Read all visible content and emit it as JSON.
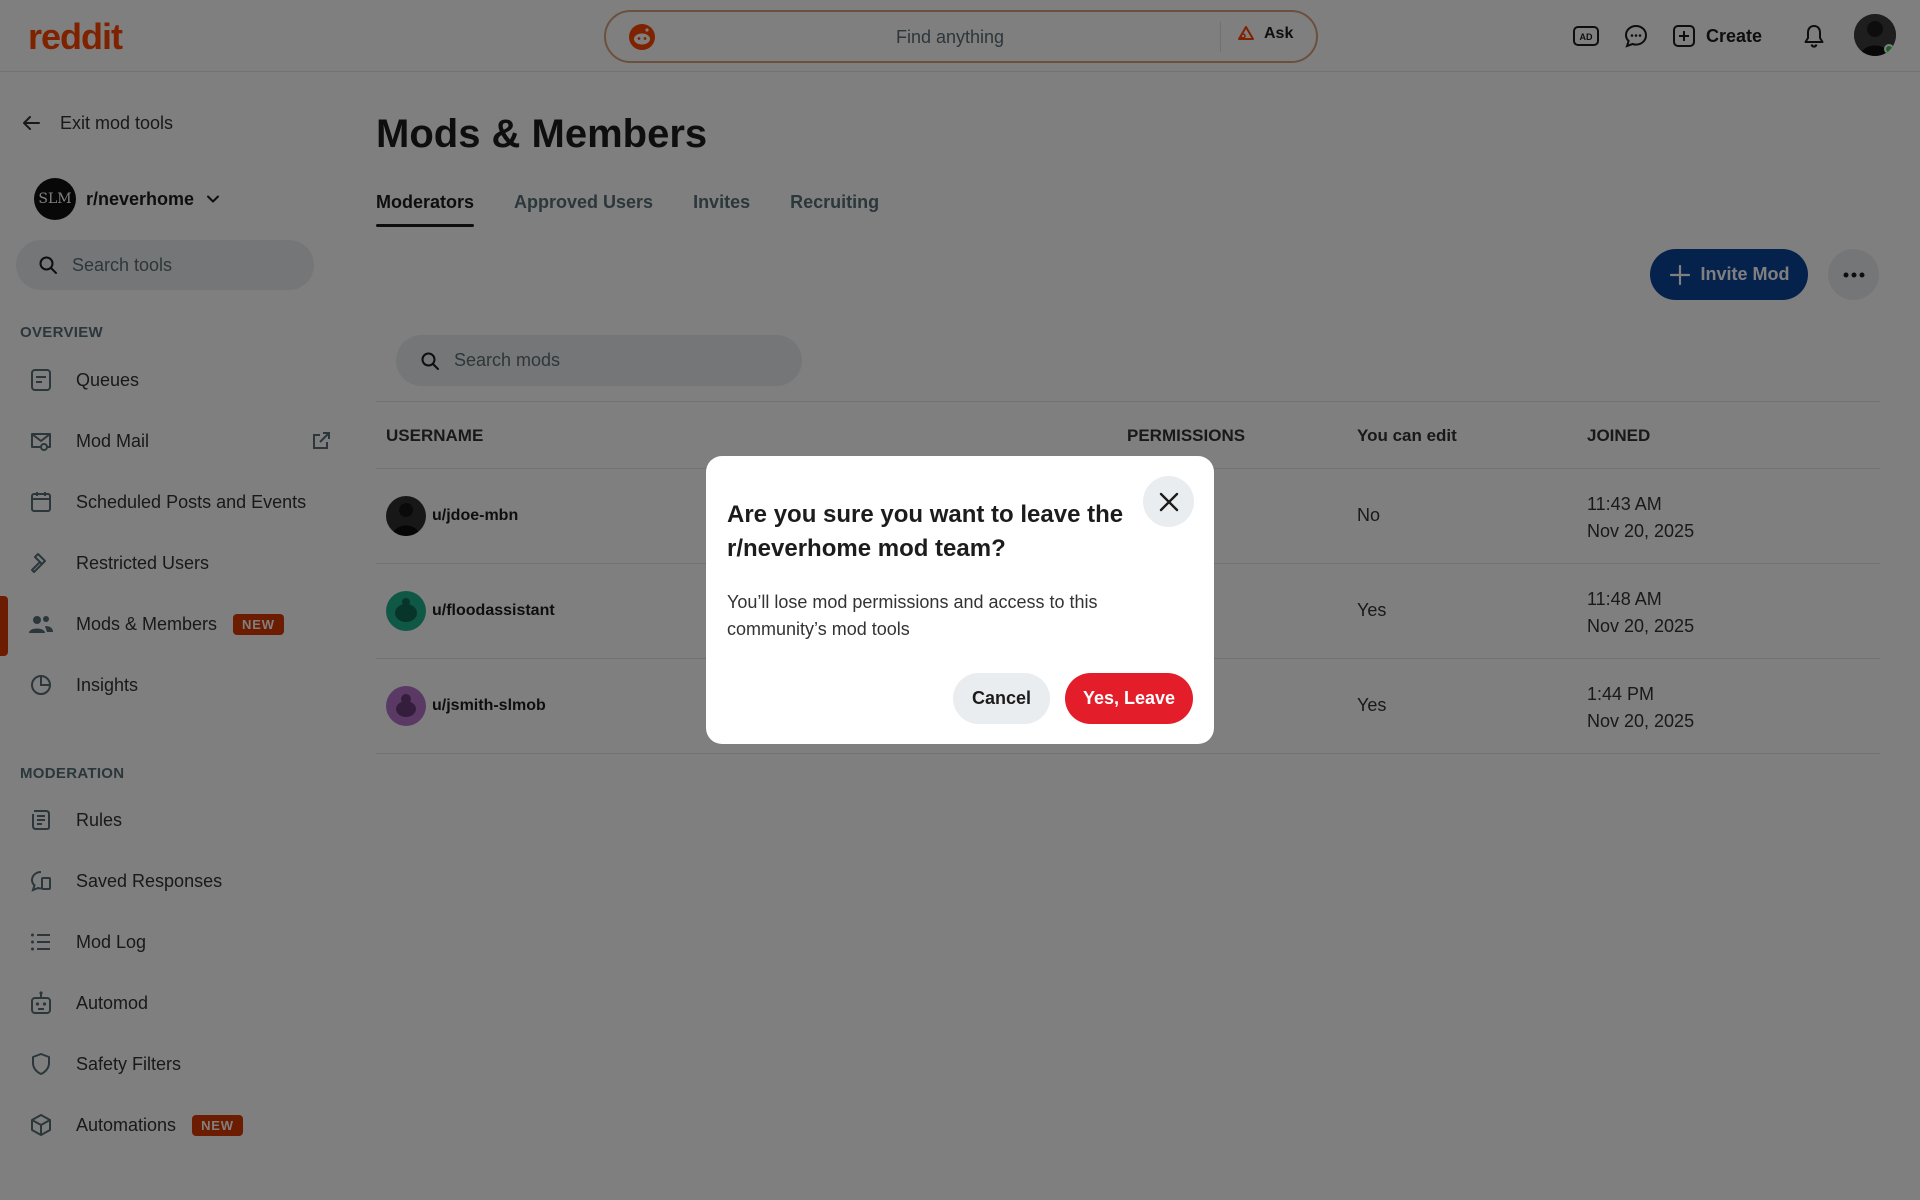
{
  "header": {
    "logo": "reddit",
    "search_placeholder": "Find anything",
    "ask_label": "Ask",
    "create_label": "Create"
  },
  "sidebar": {
    "exit_label": "Exit mod tools",
    "community": "r/neverhome",
    "community_avatar_text": "SLM",
    "search_placeholder": "Search tools",
    "overview_title": "OVERVIEW",
    "overview_items": [
      {
        "label": "Queues",
        "icon": "queue-icon"
      },
      {
        "label": "Mod Mail",
        "icon": "mail-icon"
      },
      {
        "label": "Scheduled Posts and Events",
        "icon": "calendar-icon"
      },
      {
        "label": "Restricted Users",
        "icon": "hammer-icon"
      },
      {
        "label": "Mods & Members",
        "icon": "members-icon",
        "badge": "NEW",
        "active": true
      },
      {
        "label": "Insights",
        "icon": "insights-icon"
      }
    ],
    "moderation_title": "MODERATION",
    "moderation_items": [
      {
        "label": "Rules",
        "icon": "rules-icon"
      },
      {
        "label": "Saved Responses",
        "icon": "saved-responses-icon"
      },
      {
        "label": "Mod Log",
        "icon": "list-icon"
      },
      {
        "label": "Automod",
        "icon": "robot-icon"
      },
      {
        "label": "Safety Filters",
        "icon": "shield-icon"
      },
      {
        "label": "Automations",
        "icon": "cube-icon",
        "badge": "NEW"
      }
    ]
  },
  "main": {
    "title": "Mods & Members",
    "tabs": [
      "Moderators",
      "Approved Users",
      "Invites",
      "Recruiting"
    ],
    "active_tab": "Moderators",
    "invite_label": "Invite Mod",
    "search_placeholder": "Search mods",
    "columns": [
      "USERNAME",
      "PERMISSIONS",
      "You can edit",
      "JOINED"
    ],
    "rows": [
      {
        "username": "u/jdoe-mbn",
        "can_edit": "No",
        "joined_time": "11:43 AM",
        "joined_date": "Nov 20, 2025"
      },
      {
        "username": "u/floodassistant",
        "can_edit": "Yes",
        "joined_time": "11:48 AM",
        "joined_date": "Nov 20, 2025"
      },
      {
        "username": "u/jsmith-slmob",
        "can_edit": "Yes",
        "joined_time": "1:44 PM",
        "joined_date": "Nov 20, 2025"
      }
    ]
  },
  "modal": {
    "title": "Are you sure you want to leave the r/neverhome mod team?",
    "body": "You’ll lose mod permissions and access to this community’s mod tools",
    "cancel_label": "Cancel",
    "confirm_label": "Yes, Leave"
  },
  "colors": {
    "brand": "#ff4500",
    "accent_blue": "#0a449b",
    "danger": "#e41d2b",
    "active_marker": "#d93900"
  }
}
